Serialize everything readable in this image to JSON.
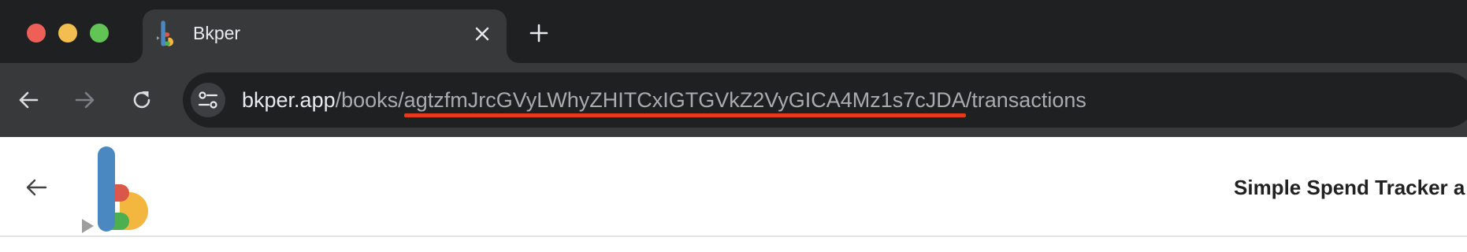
{
  "window": {
    "controls": [
      "close",
      "minimize",
      "zoom"
    ]
  },
  "tab": {
    "title": "Bkper",
    "favicon": "bkper-logo-icon",
    "close_icon": "close-icon"
  },
  "new_tab_icon": "plus-icon",
  "toolbar": {
    "back_icon": "arrow-left-icon",
    "forward_icon": "arrow-right-icon",
    "reload_icon": "reload-icon",
    "site_info_icon": "tune-icon"
  },
  "address_bar": {
    "host": "bkper.app",
    "path_prefix": "/books/",
    "book_id": "agtzfmJrcGVyLWhyZHITCxIGTGVkZ2VyGICA4Mz1s7cJDA",
    "path_suffix": "/transactions"
  },
  "annotation": {
    "underline_color": "#e43a1d"
  },
  "page": {
    "back_icon": "arrow-left-icon",
    "logo": "bkper-logo",
    "book_title": "Simple Spend Tracker a"
  },
  "colors": {
    "logo_blue": "#4a88c2",
    "logo_red": "#d9584a",
    "logo_yellow": "#f3b63e",
    "logo_green": "#4caf50"
  }
}
